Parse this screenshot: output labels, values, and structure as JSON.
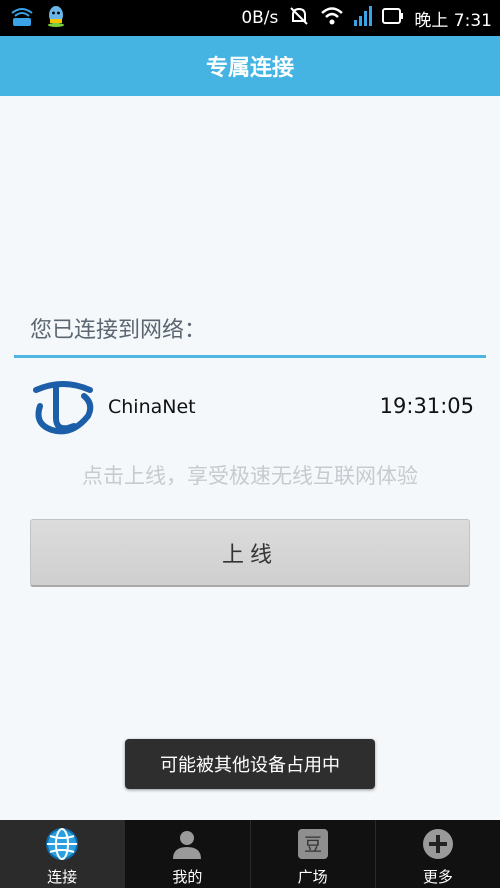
{
  "status_bar": {
    "speed": "0B/s",
    "time": "晚上 7:31",
    "icons": [
      "wifi-app-icon",
      "qq-icon",
      "mute-icon",
      "wifi-signal-icon",
      "cell-signal-icon",
      "battery-icon"
    ]
  },
  "header": {
    "title": "专属连接"
  },
  "main": {
    "connected_label": "您已连接到网络：",
    "network": {
      "name": "ChinaNet",
      "time": "19:31:05",
      "logo": "china-telecom-logo"
    },
    "hint": "点击上线，享受极速无线互联网体验",
    "online_button": "上线"
  },
  "toast": {
    "message": "可能被其他设备占用中"
  },
  "tabs": [
    {
      "label": "连接",
      "icon": "globe-icon",
      "active": true
    },
    {
      "label": "我的",
      "icon": "user-icon",
      "active": false
    },
    {
      "label": "广场",
      "icon": "bean-icon",
      "active": false
    },
    {
      "label": "更多",
      "icon": "plus-icon",
      "active": false
    }
  ],
  "colors": {
    "accent": "#45b4e3",
    "tab_bar": "#111111",
    "toast_bg": "#2e2e2e"
  }
}
